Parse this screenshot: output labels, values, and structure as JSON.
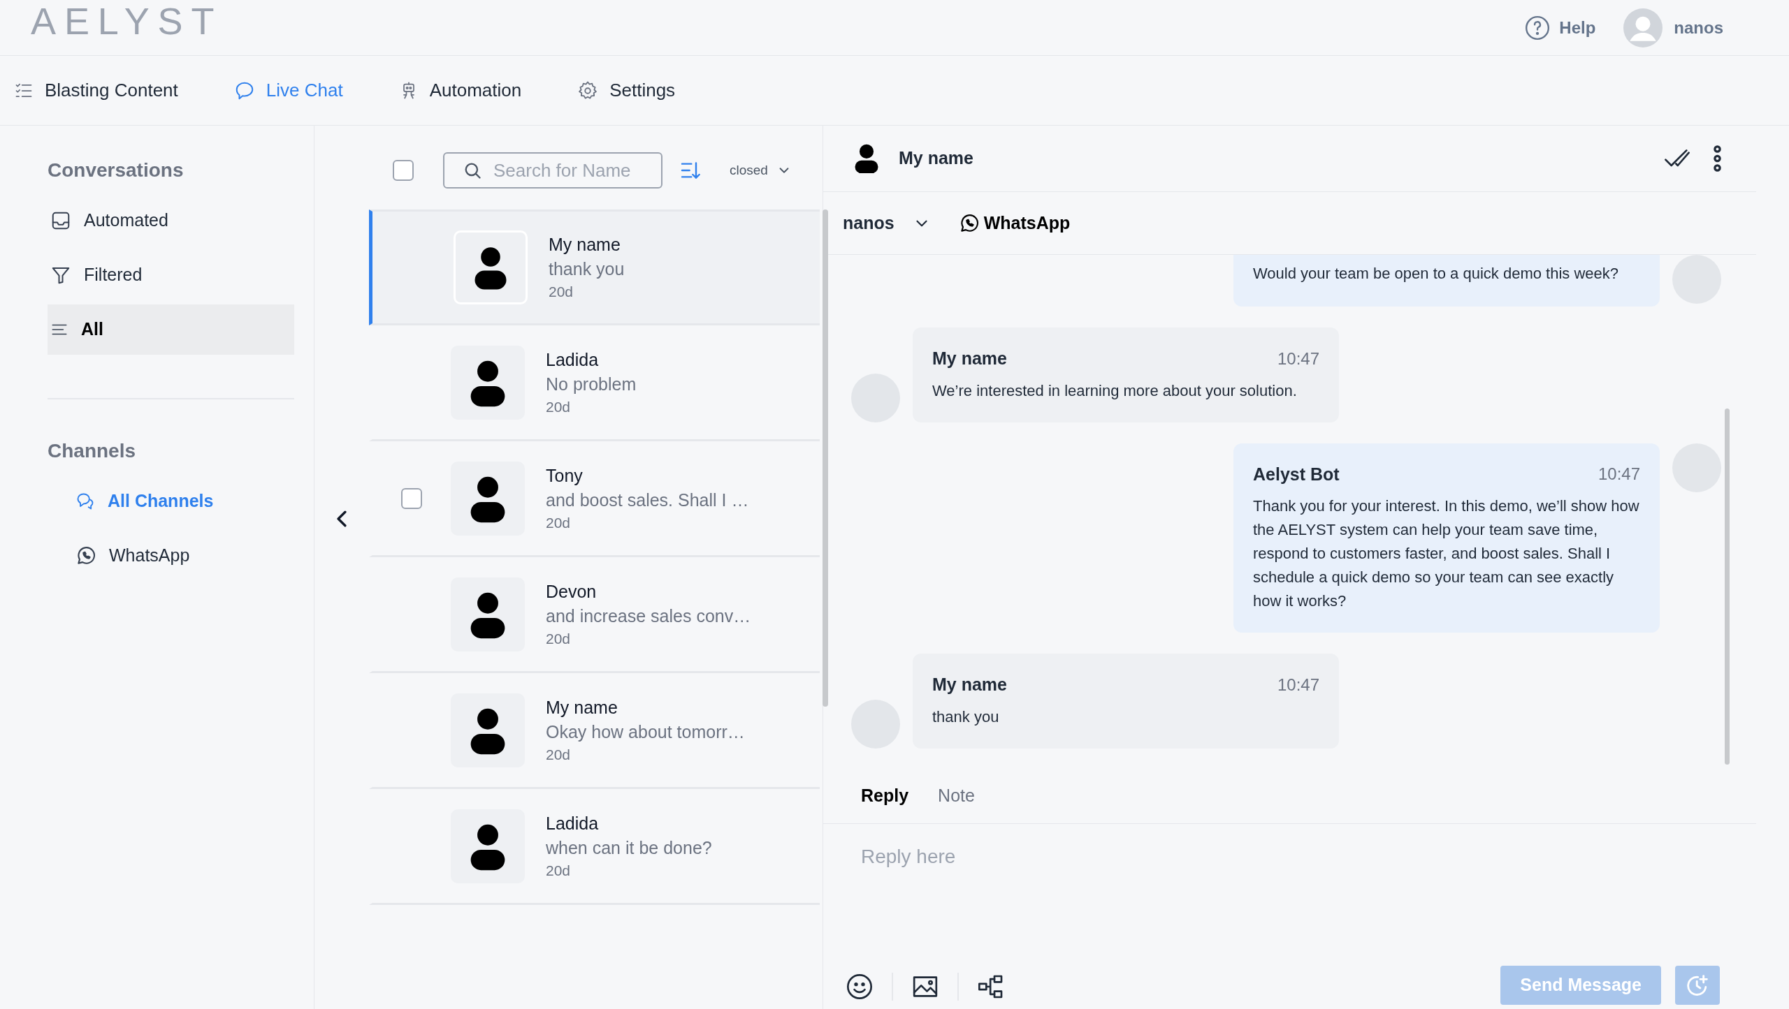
{
  "header": {
    "logo": "AELYST",
    "help": "Help",
    "user": "nanos"
  },
  "nav": [
    {
      "label": "Blasting Content",
      "selected": false
    },
    {
      "label": "Live Chat",
      "selected": true
    },
    {
      "label": "Automation",
      "selected": false
    },
    {
      "label": "Settings",
      "selected": false
    }
  ],
  "sidebar": {
    "conversations_title": "Conversations",
    "conversations": [
      {
        "label": "Automated",
        "selected": false
      },
      {
        "label": "Filtered",
        "selected": false
      },
      {
        "label": "All",
        "selected": true
      }
    ],
    "channels_title": "Channels",
    "channels": [
      {
        "label": "All Channels",
        "selected": true
      },
      {
        "label": "WhatsApp",
        "selected": false
      }
    ]
  },
  "list": {
    "select_all_checked": false,
    "search": {
      "placeholder": "Search for Name"
    },
    "status_filter": "closed",
    "rows": [
      {
        "name": "My name",
        "preview": "thank you",
        "age": "20d",
        "selected": true,
        "hovered": false
      },
      {
        "name": "Ladida",
        "preview": "No problem",
        "age": "20d",
        "selected": false,
        "hovered": false
      },
      {
        "name": "Tony",
        "preview": "and boost sales. Shall I …",
        "age": "20d",
        "selected": false,
        "hovered": true
      },
      {
        "name": "Devon",
        "preview": "and increase sales conv…",
        "age": "20d",
        "selected": false,
        "hovered": false
      },
      {
        "name": "My name",
        "preview": "Okay how about tomorr…",
        "age": "20d",
        "selected": false,
        "hovered": false
      },
      {
        "name": "Ladida",
        "preview": "when can it be done?",
        "age": "20d",
        "selected": false,
        "hovered": false
      }
    ]
  },
  "chat": {
    "contact": "My name",
    "agent": "nanos",
    "channel": "WhatsApp",
    "messages": [
      {
        "kind": "outgoing",
        "text": "Would your team be open to a quick demo this week?"
      },
      {
        "kind": "incoming",
        "sender": "My name",
        "time": "10:47",
        "text": "We’re interested in learning more about your solution."
      },
      {
        "kind": "outgoing",
        "sender": "Aelyst Bot",
        "time": "10:47",
        "text": "Thank you for your interest. In this demo, we’ll show how the AELYST system can help your team save time, respond to customers faster, and boost sales. Shall I schedule a quick demo so your team can see exactly how it works?"
      },
      {
        "kind": "incoming",
        "sender": "My name",
        "time": "10:47",
        "text": "thank you"
      }
    ],
    "tabs": [
      {
        "label": "Reply",
        "selected": true
      },
      {
        "label": "Note",
        "selected": false
      }
    ],
    "composer": {
      "placeholder": "Reply here"
    },
    "send": {
      "label": "Send Message",
      "disabled": true
    }
  }
}
